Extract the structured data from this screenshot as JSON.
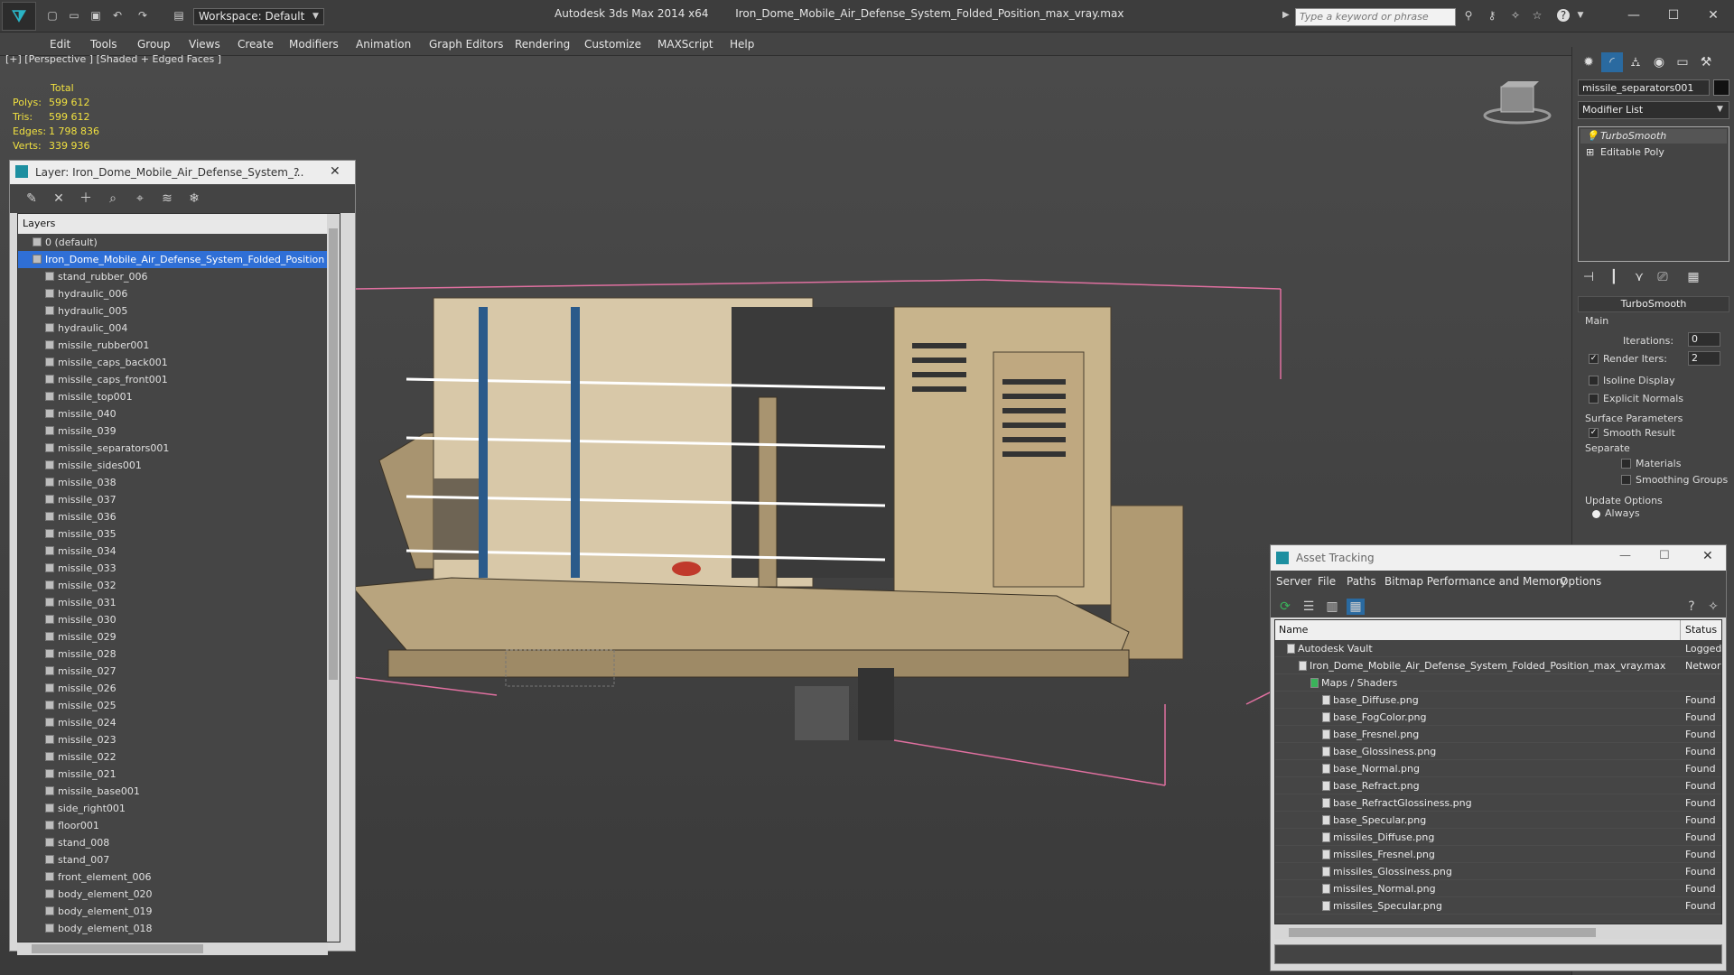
{
  "titlebar": {
    "workspace": "Workspace: Default",
    "app_name": "Autodesk 3ds Max  2014 x64",
    "file_name": "Iron_Dome_Mobile_Air_Defense_System_Folded_Position_max_vray.max",
    "search_placeholder": "Type a keyword or phrase"
  },
  "menu": [
    "Edit",
    "Tools",
    "Group",
    "Views",
    "Create",
    "Modifiers",
    "Animation",
    "Graph Editors",
    "Rendering",
    "Customize",
    "MAXScript",
    "Help"
  ],
  "viewport": {
    "label": "[+] [Perspective ] [Shaded + Edged Faces ]",
    "stats_header": "Total",
    "stats": [
      {
        "label": "Polys:",
        "value": "599 612"
      },
      {
        "label": "Tris:",
        "value": "599 612"
      },
      {
        "label": "Edges:",
        "value": "1 798 836"
      },
      {
        "label": "Verts:",
        "value": "339 936"
      }
    ]
  },
  "layer_panel": {
    "title": "Layer: Iron_Dome_Mobile_Air_Defense_System_...",
    "help": "?",
    "header": "Layers",
    "layers": [
      "0 (default)",
      "Iron_Dome_Mobile_Air_Defense_System_Folded_Position",
      "stand_rubber_006",
      "hydraulic_006",
      "hydraulic_005",
      "hydraulic_004",
      "missile_rubber001",
      "missile_caps_back001",
      "missile_caps_front001",
      "missile_top001",
      "missile_040",
      "missile_039",
      "missile_separators001",
      "missile_sides001",
      "missile_038",
      "missile_037",
      "missile_036",
      "missile_035",
      "missile_034",
      "missile_033",
      "missile_032",
      "missile_031",
      "missile_030",
      "missile_029",
      "missile_028",
      "missile_027",
      "missile_026",
      "missile_025",
      "missile_024",
      "missile_023",
      "missile_022",
      "missile_021",
      "missile_base001",
      "side_right001",
      "floor001",
      "stand_008",
      "stand_007",
      "front_element_006",
      "body_element_020",
      "body_element_019",
      "body_element_018"
    ]
  },
  "command_panel": {
    "object_name": "missile_separators001",
    "modifier_list": "Modifier List",
    "stack": [
      "TurboSmooth",
      "Editable Poly"
    ],
    "turbosmooth": {
      "title": "TurboSmooth",
      "main": "Main",
      "iterations_label": "Iterations:",
      "iterations": "0",
      "render_iters_label": "Render Iters:",
      "render_iters": "2",
      "isoline": "Isoline Display",
      "explicit": "Explicit Normals",
      "surface_params": "Surface Parameters",
      "smooth_result": "Smooth Result",
      "separate": "Separate",
      "materials": "Materials",
      "smoothing_groups": "Smoothing Groups",
      "update_options": "Update Options",
      "always": "Always"
    }
  },
  "asset_tracking": {
    "title": "Asset Tracking",
    "menu": [
      "Server",
      "File",
      "Paths",
      "Bitmap Performance and Memory",
      "Options"
    ],
    "col_name": "Name",
    "col_status": "Status",
    "rows": [
      {
        "name": "Autodesk Vault",
        "status": "Logged O",
        "indent": 1
      },
      {
        "name": "Iron_Dome_Mobile_Air_Defense_System_Folded_Position_max_vray.max",
        "status": "Network",
        "indent": 2
      },
      {
        "name": "Maps / Shaders",
        "status": "",
        "indent": 3
      },
      {
        "name": "base_Diffuse.png",
        "status": "Found",
        "indent": 4
      },
      {
        "name": "base_FogColor.png",
        "status": "Found",
        "indent": 4
      },
      {
        "name": "base_Fresnel.png",
        "status": "Found",
        "indent": 4
      },
      {
        "name": "base_Glossiness.png",
        "status": "Found",
        "indent": 4
      },
      {
        "name": "base_Normal.png",
        "status": "Found",
        "indent": 4
      },
      {
        "name": "base_Refract.png",
        "status": "Found",
        "indent": 4
      },
      {
        "name": "base_RefractGlossiness.png",
        "status": "Found",
        "indent": 4
      },
      {
        "name": "base_Specular.png",
        "status": "Found",
        "indent": 4
      },
      {
        "name": "missiles_Diffuse.png",
        "status": "Found",
        "indent": 4
      },
      {
        "name": "missiles_Fresnel.png",
        "status": "Found",
        "indent": 4
      },
      {
        "name": "missiles_Glossiness.png",
        "status": "Found",
        "indent": 4
      },
      {
        "name": "missiles_Normal.png",
        "status": "Found",
        "indent": 4
      },
      {
        "name": "missiles_Specular.png",
        "status": "Found",
        "indent": 4
      }
    ]
  },
  "colors": {
    "selection": "#2f6fd6",
    "stats_yellow": "#f0e040",
    "model_tan": "#c8b48c",
    "bbox_pink": "#e070a0"
  }
}
